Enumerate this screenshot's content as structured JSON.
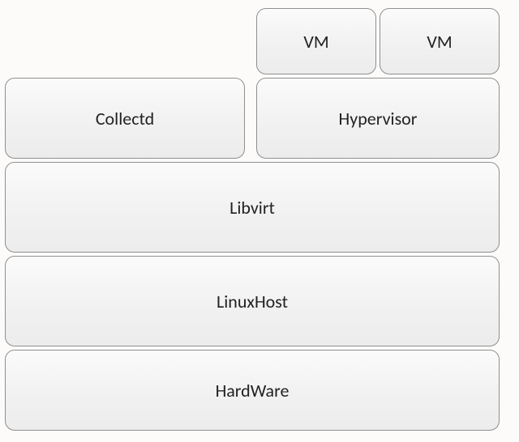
{
  "layers": {
    "vm1": "VM",
    "vm2": "VM",
    "collectd": "Collectd",
    "hypervisor": "Hypervisor",
    "libvirt": "Libvirt",
    "linuxhost": "LinuxHost",
    "hardware": "HardWare"
  }
}
